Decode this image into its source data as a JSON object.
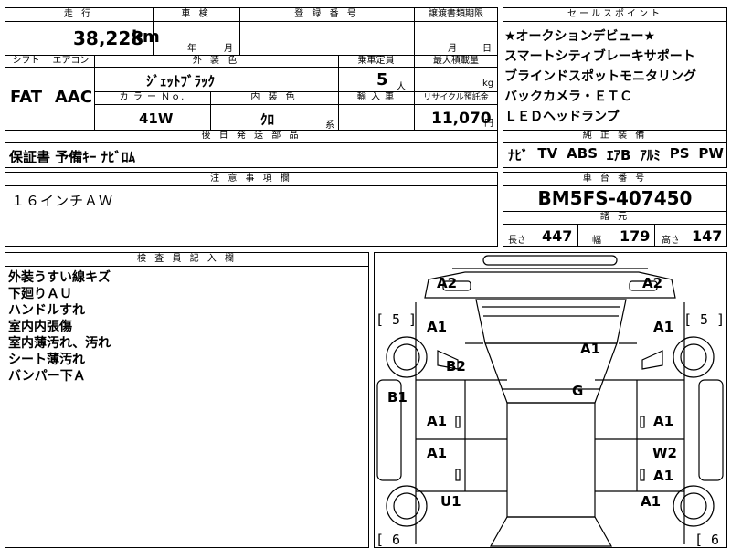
{
  "mileage": {
    "header": "走 行",
    "value": "38,228",
    "unit": "km"
  },
  "shaken": {
    "header": "車 検",
    "year_label": "年",
    "month_label": "月"
  },
  "registration": {
    "header": "登 録 番 号"
  },
  "transfer_deadline": {
    "header": "譲渡書類期限",
    "month_label": "月",
    "day_label": "日"
  },
  "shift": {
    "header": "シフト",
    "value": "FAT"
  },
  "aircon": {
    "header": "エアコン",
    "value": "AAC"
  },
  "exterior_color": {
    "header": "外 装 色",
    "value": "ｼﾞｪｯﾄﾌﾞﾗｯｸ"
  },
  "capacity": {
    "header": "乗車定員",
    "value": "5",
    "unit": "人"
  },
  "max_load": {
    "header": "最大積載量",
    "unit": "kg"
  },
  "color_no": {
    "header": "カ ラ ー Ｎｏ.",
    "value": "41W"
  },
  "interior_color": {
    "header": "内 装 色",
    "value": "ｸﾛ",
    "suffix": "系"
  },
  "import": {
    "header": "輸 入 車"
  },
  "recycle": {
    "header": "リサイクル預託金",
    "value": "11,070",
    "unit": "円"
  },
  "later_parts": {
    "header": "後 日 発 送 部 品",
    "value": "保証書 予備ｷｰ ﾅﾋﾞﾛﾑ"
  },
  "notes": {
    "header": "注 意 事 項 欄",
    "value": "１６インチＡＷ"
  },
  "sales_points": {
    "header": "セールスポイント",
    "items": [
      "★オークションデビュー★",
      "スマートシティブレーキサポート",
      "ブラインドスポットモニタリング",
      "バックカメラ・ＥＴＣ",
      "ＬＥＤヘッドランプ"
    ]
  },
  "equipment": {
    "header": "純 正 装 備",
    "items": [
      "ﾅﾋﾞ",
      "TV",
      "ABS",
      "ｴｱB",
      "ｱﾙﾐ",
      "PS",
      "PW"
    ]
  },
  "chassis": {
    "header": "車 台 番 号",
    "value": "BM5FS-407450"
  },
  "specs": {
    "header": "諸 元",
    "length_label": "長さ",
    "length": "447",
    "width_label": "幅",
    "width": "179",
    "height_label": "高さ",
    "height": "147"
  },
  "inspector": {
    "header": "検 査 員 記 入 欄",
    "lines": [
      "外装うすい線キズ",
      "下廻りＡＵ",
      "ハンドルすれ",
      "室内内張傷",
      "室内薄汚れ、汚れ",
      "シート薄汚れ",
      "バンパー下Ａ"
    ]
  },
  "diagram": {
    "labels": {
      "front_left": "A2",
      "front_right": "A2",
      "bracket_left_top": "[ 5 ]",
      "bracket_right_top": "[ 5 ]",
      "fender_left": "A1",
      "fender_right": "A1",
      "hood": "A1",
      "pillar_left": "B2",
      "roof": "G",
      "sill_left": "B1",
      "front_door_left": "A1",
      "front_door_right": "A1",
      "rear_door_left": "A1",
      "rear_door_right_w": "W2",
      "rear_door_right_a": "A1",
      "rear_fender_left": "U1",
      "rear_fender_right": "A1",
      "bracket_left_bottom": "[ 6",
      "bracket_right_bottom": "[ 6"
    }
  }
}
